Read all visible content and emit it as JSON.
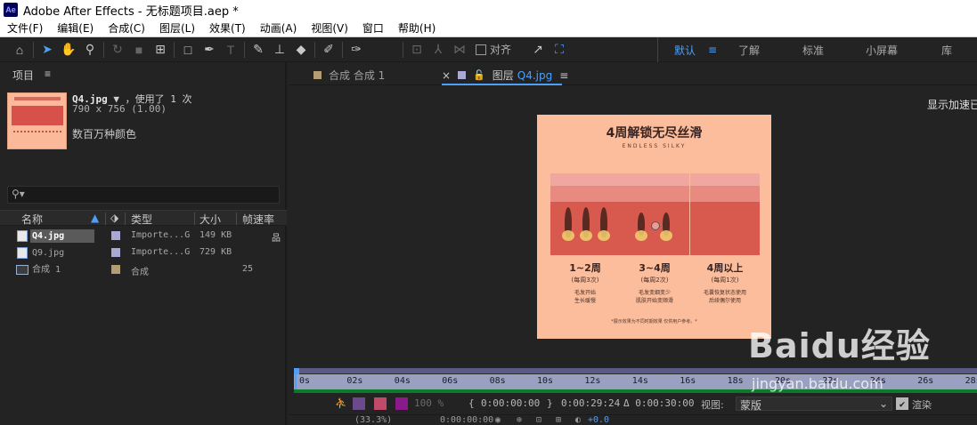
{
  "app": {
    "logo_text": "Ae",
    "title": "Adobe After Effects - 无标题项目.aep *"
  },
  "menu": [
    "文件(F)",
    "编辑(E)",
    "合成(C)",
    "图层(L)",
    "效果(T)",
    "动画(A)",
    "视图(V)",
    "窗口",
    "帮助(H)"
  ],
  "toolbar": {
    "snap_label": "对齐",
    "workspaces": [
      "默认",
      "了解",
      "标准",
      "小屏幕",
      "库"
    ],
    "workspace_menu_icon": "≡"
  },
  "project_panel": {
    "tab_label": "项目",
    "selected_item": {
      "name": "Q4.jpg",
      "usage": "，使用了 1 次",
      "dimensions": "790 x 756 (1.00)",
      "colors": "数百万种颜色"
    },
    "search_placeholder": "",
    "columns": [
      "名称",
      "类型",
      "大小",
      "帧速率"
    ],
    "items": [
      {
        "name": "Q4.jpg",
        "type": "Importe...G",
        "size": "149 KB",
        "fps": "",
        "label_color": "#a9a9d4",
        "kind": "file",
        "selected": true
      },
      {
        "name": "Q9.jpg",
        "type": "Importe...G",
        "size": "729 KB",
        "fps": "",
        "label_color": "#a9a9d4",
        "kind": "file",
        "selected": false
      },
      {
        "name": "合成 1",
        "type": "合成",
        "size": "",
        "fps": "25",
        "label_color": "#b39d74",
        "kind": "comp",
        "selected": false
      }
    ]
  },
  "viewer": {
    "comp_tab": "合成 合成 1",
    "layer_tab_prefix": "图层",
    "layer_tab_file": "Q4.jpg",
    "gpu_label": "显示加速已",
    "poster": {
      "title": "4周解锁无尽丝滑",
      "subtitle": "ENDLESS SILKY",
      "stages": [
        {
          "title": "1~2周",
          "sub": "(每周3次)",
          "desc": [
            "毛发开始",
            "生长缓慢"
          ]
        },
        {
          "title": "3~4周",
          "sub": "(每周2次)",
          "desc": [
            "毛发变细变少",
            "肌肤开始变顺滑"
          ]
        },
        {
          "title": "4周以上",
          "sub": "(每周1次)",
          "desc": [
            "毛囊恢复状态使用",
            "后续偶尔使用"
          ]
        }
      ],
      "note": "*展示效果为不同时期效果 仅供用户参考。*"
    }
  },
  "timeline": {
    "ticks": [
      "0s",
      "02s",
      "04s",
      "06s",
      "08s",
      "10s",
      "12s",
      "14s",
      "16s",
      "18s",
      "20s",
      "22s",
      "24s",
      "26s",
      "28s"
    ],
    "zoom_percent": "100 %",
    "in_point": "0:00:00:00",
    "out_point": "0:00:29:24",
    "duration": "Δ 0:00:30:00",
    "view_label": "视图:",
    "view_value": "蒙版",
    "render_label": "渲染",
    "bottom_zoom": "(33.3%)",
    "bottom_time": "0:00:00:00",
    "bottom_offset": "+0.0"
  },
  "watermark": {
    "logo": "Baidu经验",
    "url": "jingyan.baidu.com"
  }
}
